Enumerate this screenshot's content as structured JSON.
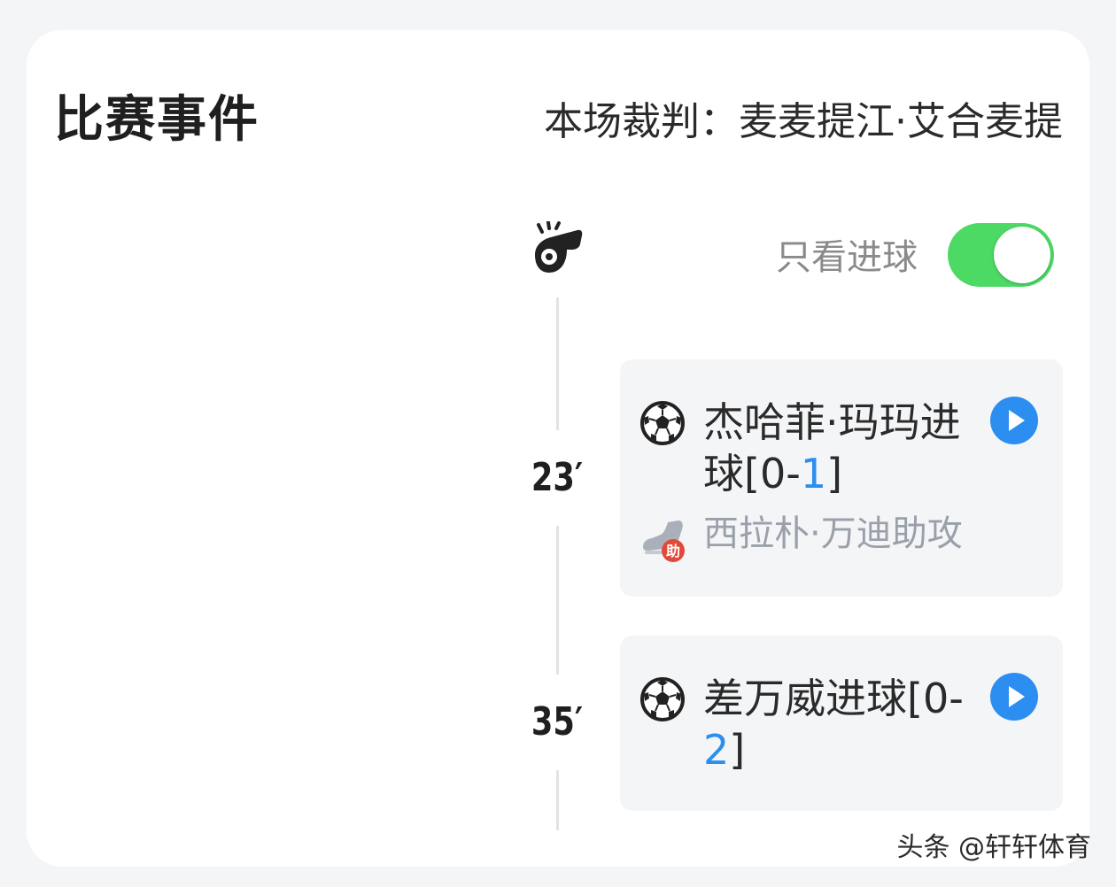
{
  "header": {
    "title": "比赛事件",
    "referee": "本场裁判：麦麦提江·艾合麦提"
  },
  "filter": {
    "goals_only_label": "只看进球",
    "goals_only_on": true,
    "toggle_color": "#4cd964"
  },
  "events": [
    {
      "minute": "23′",
      "icon": "soccer-ball-icon",
      "player_text": "杰哈菲·玛玛进球[0-",
      "score_highlight": "1",
      "score_suffix": "]",
      "assist_icon": "boot-assist-icon",
      "assist_badge": "助",
      "assist": "西拉朴·万迪助攻"
    },
    {
      "minute": "35′",
      "icon": "soccer-ball-icon",
      "player_text": "差万威进球[0-",
      "score_highlight": "2",
      "score_suffix": "]"
    }
  ],
  "colors": {
    "score_highlight": "#2b8ef0",
    "play_button": "#2b8ef0"
  },
  "watermark": "头条 @轩轩体育"
}
